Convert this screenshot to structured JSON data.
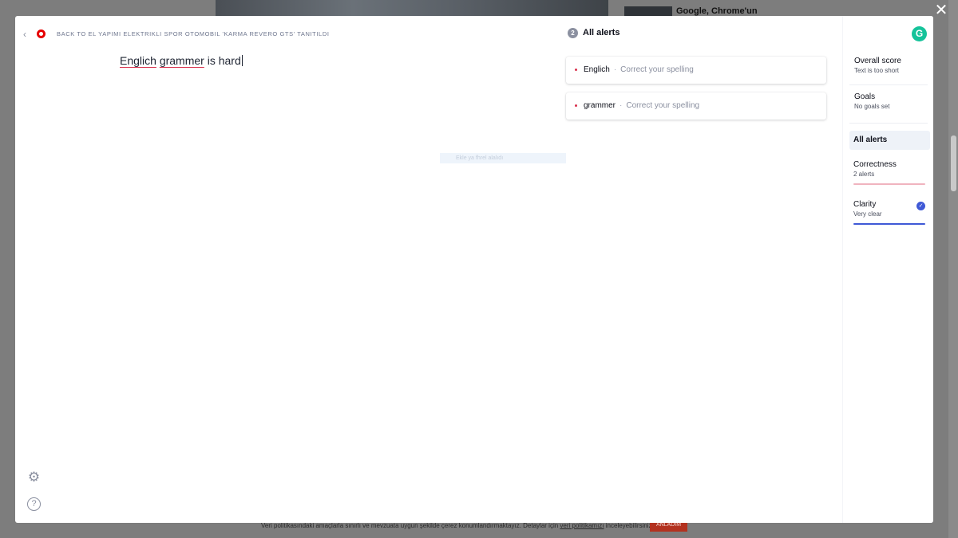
{
  "background": {
    "headline": "Google, Chrome'un",
    "cookie_text": "Veri politikasındaki amaçlarla sınırlı ve mevzuata uygun şekilde çerez konumlandırmaktayız. Detaylar için",
    "cookie_link": "veri politikamızı",
    "cookie_suffix": "inceleyebilirsiniz.",
    "cookie_button": "ANLADIM",
    "close_glyph": "✕"
  },
  "header": {
    "back_glyph": "‹",
    "title": "BACK TO EL YAPIMI ELEKTRIKLI SPOR OTOMOBIL 'KARMA REVERO GTS' TANITILDI"
  },
  "editor": {
    "words": [
      "Englich",
      "grammer",
      "is hard"
    ],
    "faint_text": "Ekle ya fhrel alalıdı"
  },
  "alerts": {
    "count": "2",
    "heading": "All alerts",
    "items": [
      {
        "word": "Englich",
        "hint": "Correct your spelling"
      },
      {
        "word": "grammer",
        "hint": "Correct your spelling"
      }
    ]
  },
  "sidebar": {
    "logo": "G",
    "overall_title": "Overall score",
    "overall_sub": "Text is too short",
    "goals_title": "Goals",
    "goals_sub": "No goals set",
    "nav_all": "All alerts",
    "correctness_title": "Correctness",
    "correctness_sub": "2 alerts",
    "clarity_title": "Clarity",
    "clarity_sub": "Very clear"
  },
  "icons": {
    "settings": "gear-icon",
    "help": "help-icon",
    "gear_glyph": "⚙",
    "help_glyph": "?",
    "check_glyph": "✓"
  },
  "colors": {
    "grammarly_green": "#15c39a",
    "error_red": "#d9314d",
    "clarity_blue": "#3f59d6"
  }
}
